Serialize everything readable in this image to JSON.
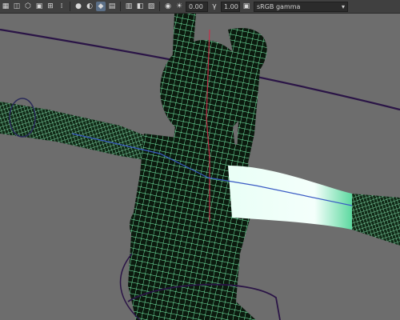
{
  "toolbar": {
    "icons": [
      "select-icon",
      "move-icon",
      "rotate-icon",
      "scale-icon",
      "grid-icon",
      "wire-icon",
      "smooth-icon",
      "xray-icon",
      "joint-icon",
      "camera-icon",
      "light-icon",
      "shadow-icon",
      "aa-icon",
      "isolate-icon",
      "exposure-icon",
      "gamma-icon",
      "colorspace-icon"
    ],
    "exposure_value": "0.00",
    "gamma_value": "1.00",
    "colorspace": "sRGB gamma"
  },
  "colors": {
    "viewport_bg": "#6d6d6d",
    "mesh_body": "#0b1a0e",
    "wire_primary": "#7dffb5",
    "wire_selected": "#e9fff6",
    "nurbs_curve": "#2a1446"
  }
}
